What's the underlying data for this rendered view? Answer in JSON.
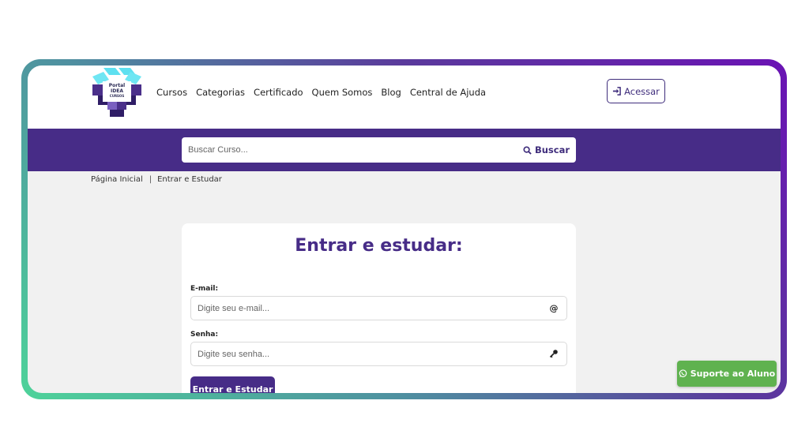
{
  "brand": {
    "logo_line1": "Portal",
    "logo_line2": "IDEA",
    "logo_line3": "CURSOS"
  },
  "nav": {
    "items": [
      "Cursos",
      "Categorias",
      "Certificado",
      "Quem Somos",
      "Blog",
      "Central de Ajuda"
    ],
    "access_label": "Acessar"
  },
  "search": {
    "placeholder": "Buscar Curso...",
    "button_label": "Buscar"
  },
  "breadcrumb": {
    "home": "Página Inicial",
    "separator": "|",
    "current": "Entrar e Estudar"
  },
  "login": {
    "title": "Entrar e estudar:",
    "email_label": "E-mail:",
    "email_placeholder": "Digite seu e-mail...",
    "email_icon": "@",
    "password_label": "Senha:",
    "password_placeholder": "Digite seu senha...",
    "submit_label": "Entrar e Estudar"
  },
  "support": {
    "label": "Suporte ao Aluno"
  },
  "colors": {
    "primary": "#472c87",
    "support_green": "#5fb24f",
    "logo_cyan": "#5ee0f0",
    "logo_purple": "#4a2f8a"
  }
}
